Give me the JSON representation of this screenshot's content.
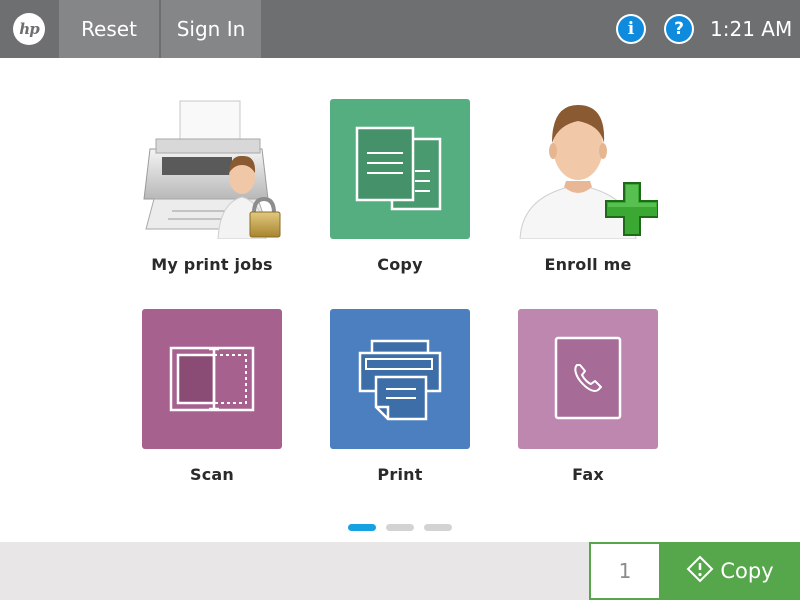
{
  "header": {
    "logo_text": "hp",
    "reset_label": "Reset",
    "signin_label": "Sign In",
    "info_icon": "info-icon",
    "help_icon": "help-icon",
    "info_glyph": "i",
    "help_glyph": "?",
    "time": "1:21 AM"
  },
  "tiles": [
    {
      "label": "My print jobs",
      "icon": "printer-lock-user-icon"
    },
    {
      "label": "Copy",
      "icon": "copy-documents-icon",
      "color": "#55ae80"
    },
    {
      "label": "Enroll me",
      "icon": "user-add-icon"
    },
    {
      "label": "Scan",
      "icon": "scan-icon",
      "color": "#a7618f"
    },
    {
      "label": "Print",
      "icon": "printer-icon",
      "color": "#4b7fc0"
    },
    {
      "label": "Fax",
      "icon": "fax-phone-icon",
      "color": "#bd87b0"
    }
  ],
  "pagination": {
    "pages": 3,
    "active": 1,
    "active_color": "#16a1e2"
  },
  "footer": {
    "copies_value": "1",
    "copy_button_label": "Copy",
    "copy_button_icon": "start-diamond-icon",
    "accent": "#56a64b"
  }
}
